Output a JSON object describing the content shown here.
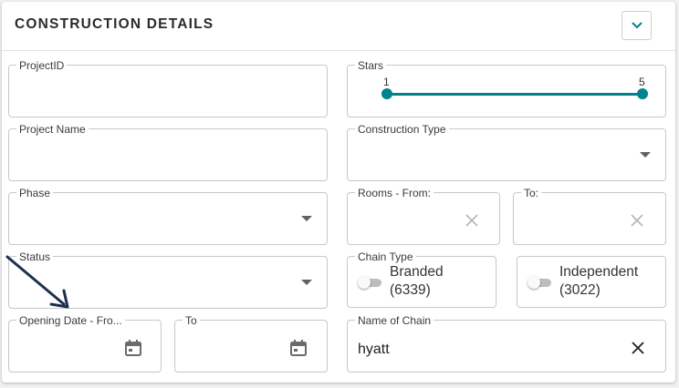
{
  "header": {
    "title": "CONSTRUCTION DETAILS",
    "collapse_icon": "chevron-down-icon"
  },
  "fields": {
    "project_id": {
      "label": "ProjectID",
      "value": ""
    },
    "project_name": {
      "label": "Project Name",
      "value": ""
    },
    "phase": {
      "label": "Phase",
      "value": ""
    },
    "status": {
      "label": "Status",
      "value": ""
    },
    "opening_date_from": {
      "label": "Opening Date - Fro...",
      "value": ""
    },
    "opening_date_to": {
      "label": "To",
      "value": ""
    },
    "stars": {
      "label": "Stars",
      "min": "1",
      "max": "5",
      "selected_min": 1,
      "selected_max": 5
    },
    "construction_type": {
      "label": "Construction Type",
      "value": ""
    },
    "rooms_from": {
      "label": "Rooms - From:",
      "value": ""
    },
    "rooms_to": {
      "label": "To:",
      "value": ""
    },
    "chain_type": {
      "label": "Chain Type",
      "branded": {
        "name": "Branded",
        "count": "(6339)",
        "checked": false
      },
      "independent": {
        "name": "Independent",
        "count": "(3022)",
        "checked": false
      }
    },
    "name_of_chain": {
      "label": "Name of Chain",
      "value": "hyatt"
    }
  },
  "colors": {
    "accent": "#00838f",
    "annotation_arrow": "#1c2f4f"
  }
}
